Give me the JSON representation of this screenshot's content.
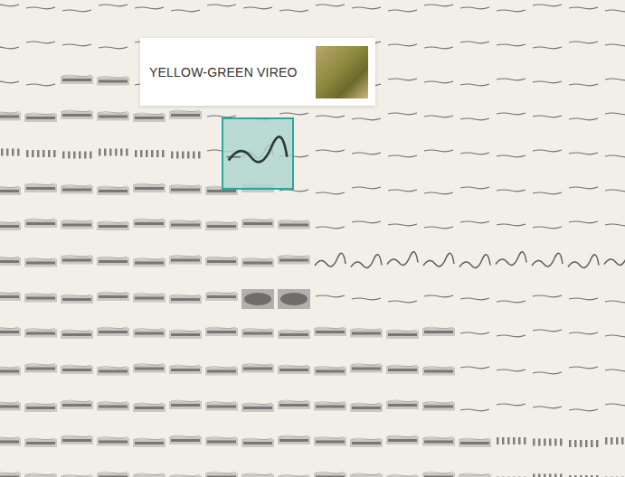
{
  "tooltip": {
    "title": "YELLOW-GREEN VIREO"
  },
  "grid": {
    "rows": [
      {
        "segments": [
          {
            "kind": "line",
            "count": 18,
            "selected": false
          }
        ]
      },
      {
        "segments": [
          {
            "kind": "line",
            "count": 18,
            "selected": false
          }
        ]
      },
      {
        "segments": [
          {
            "kind": "line",
            "count": 2,
            "selected": false
          },
          {
            "kind": "band",
            "count": 2,
            "selected": false
          },
          {
            "kind": "line",
            "count": 14,
            "selected": false
          }
        ]
      },
      {
        "segments": [
          {
            "kind": "band",
            "count": 6,
            "selected": false
          },
          {
            "kind": "line",
            "count": 12,
            "selected": false
          }
        ]
      },
      {
        "segments": [
          {
            "kind": "dots",
            "count": 6,
            "selected": false
          },
          {
            "kind": "line",
            "count": 1,
            "selected": false
          },
          {
            "kind": "wave",
            "count": 1,
            "selected": true
          },
          {
            "kind": "line",
            "count": 10,
            "selected": false
          }
        ]
      },
      {
        "segments": [
          {
            "kind": "band",
            "count": 8,
            "selected": false
          },
          {
            "kind": "line",
            "count": 10,
            "selected": false
          }
        ]
      },
      {
        "segments": [
          {
            "kind": "band",
            "count": 9,
            "selected": false
          },
          {
            "kind": "line",
            "count": 9,
            "selected": false
          }
        ]
      },
      {
        "segments": [
          {
            "kind": "band",
            "count": 9,
            "selected": false
          },
          {
            "kind": "wave",
            "count": 9,
            "selected": false
          }
        ]
      },
      {
        "segments": [
          {
            "kind": "band",
            "count": 7,
            "selected": false
          },
          {
            "kind": "blob",
            "count": 2,
            "selected": false
          },
          {
            "kind": "line",
            "count": 9,
            "selected": false
          }
        ]
      },
      {
        "segments": [
          {
            "kind": "band",
            "count": 13,
            "selected": false
          },
          {
            "kind": "line",
            "count": 5,
            "selected": false
          }
        ]
      },
      {
        "segments": [
          {
            "kind": "band",
            "count": 13,
            "selected": false
          },
          {
            "kind": "line",
            "count": 5,
            "selected": false
          }
        ]
      },
      {
        "segments": [
          {
            "kind": "band",
            "count": 13,
            "selected": false
          },
          {
            "kind": "line",
            "count": 5,
            "selected": false
          }
        ]
      },
      {
        "segments": [
          {
            "kind": "band",
            "count": 14,
            "selected": false
          },
          {
            "kind": "dots",
            "count": 4,
            "selected": false
          }
        ]
      },
      {
        "segments": [
          {
            "kind": "band",
            "count": 14,
            "selected": false
          },
          {
            "kind": "dots",
            "count": 4,
            "selected": false
          }
        ]
      }
    ]
  }
}
